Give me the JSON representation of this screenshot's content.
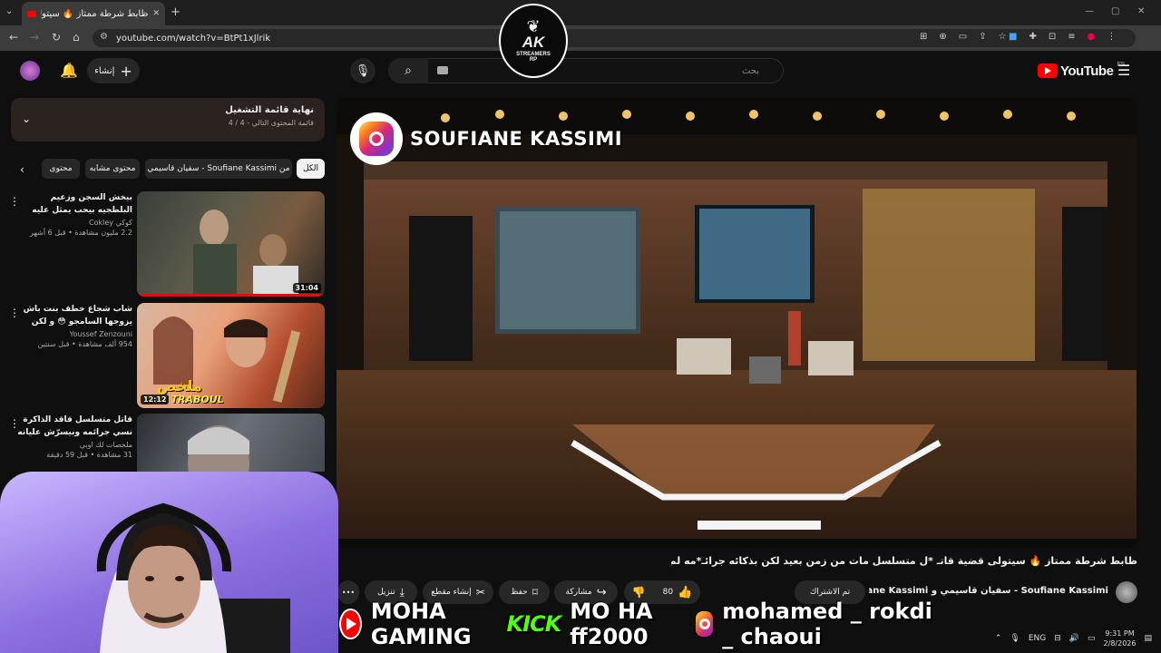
{
  "browser": {
    "tab_title": "ظابط شرطة ممتاز 🔥 سيتولى",
    "url": "youtube.com/watch?v=BtPt1xJlrik",
    "new_tab": "+",
    "tab_close": "✕"
  },
  "header": {
    "create_label": "إنشاء",
    "search_placeholder": "بحث",
    "logo_text": "YouTube",
    "logo_region": "ES"
  },
  "badge": {
    "letters": "AK",
    "sub": "STREAMERS",
    "sub2": "RP"
  },
  "playlist": {
    "title": "نهاية قائمة التشغيل",
    "subtitle": "قائمة المحتوى التالي - 4 / 4"
  },
  "chips": [
    {
      "label": "الكل"
    },
    {
      "label": "من Soufiane Kassimi - سفيان قاسيمي"
    },
    {
      "label": "محتوى مشابه"
    },
    {
      "label": "محتوى"
    }
  ],
  "related": [
    {
      "title": "بيخش السجن وزعيم البلطجيه بيحب يمثل عليه لمره ميعرفش انه وحـ...",
      "channel": "كوكي Cokley",
      "meta": "2.2 مليون مشاهدة • قبل 6 أشهر",
      "duration": "31:04",
      "progress": 1.0
    },
    {
      "title": "شاب شجاع خطف بنت باش يزوجها السامجو 😳 و لكن عجباتو ولا ...",
      "channel": "Youssef Zenzouni",
      "meta": "954 ألف مشاهدة • قبل سنتين",
      "duration": "12:12",
      "thumb_text": "ملخص",
      "thumb_text2": "A IN TRABOUL",
      "progress": 0.0
    },
    {
      "title": "قاتل متسلسل فاقد الذاكرة نسي جرائمه وبيسرّش عليانه الخطر و...",
      "channel": "ملخصات لك اوبي",
      "meta": "31 مشاهدة • قبل 59 دقيقة",
      "duration": "",
      "progress": 0.0
    }
  ],
  "video": {
    "overlay_name": "SOUFIANE KASSIMI",
    "title": "ظابط شرطة ممتاز 🔥 سيتولى قضية قاتـ *ل متسلسل مات من زمن بعيد لكن بذكائه جرائـ*مه لم تتوقف 😱",
    "channel": "Soufiane Kassimi - سفيان قاسيمي و Soufiane Kassimi",
    "subscribe": "تم الاشتراك",
    "likes": "80",
    "share": "مشاركة",
    "save": "حفظ",
    "clip": "إنشاء مقطع",
    "download": "تنزيل",
    "more": "•••"
  },
  "banner": {
    "youtube": "MOHA GAMING",
    "kick": "KICK",
    "kick_name": "MO HA ff2000",
    "instagram": "mohamed _ rokdi _ chaoui"
  },
  "taskbar": {
    "lang": "ENG",
    "time": "9:31 PM",
    "date": "2/8/2026"
  },
  "colors": {
    "accent": "#ff0000",
    "kick": "#53fc18",
    "bg": "#0f0f0f"
  }
}
